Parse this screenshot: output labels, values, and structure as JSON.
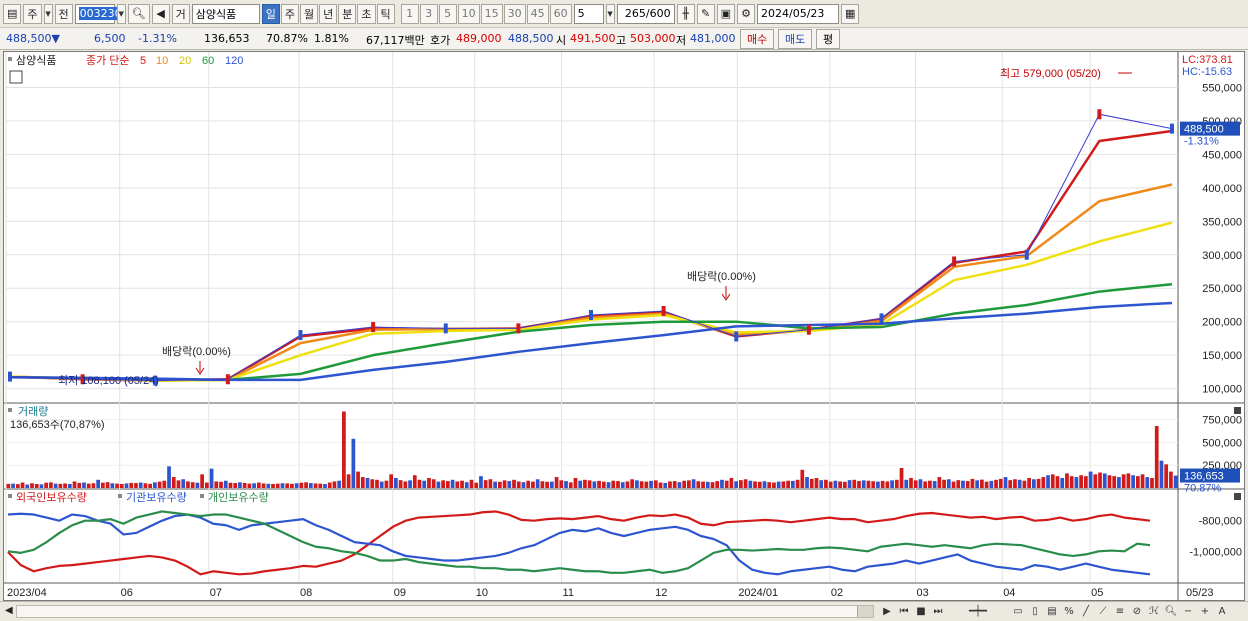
{
  "toolbar": {
    "type_label": "주",
    "prev_label": "전",
    "code": "003230",
    "exchange_label": "거",
    "stock_name": "삼양식품",
    "periods": [
      "일",
      "주",
      "월",
      "년",
      "분",
      "초",
      "틱"
    ],
    "selected_period": "일",
    "intervals": [
      "1",
      "3",
      "5",
      "10",
      "15",
      "30",
      "45",
      "60"
    ],
    "interval_value": "5",
    "count_value": "265",
    "count_max": "/600",
    "date": "2024/05/23"
  },
  "quote": {
    "price": "488,500",
    "change_symbol": "▼",
    "change": "6,500",
    "change_pct": "-1.31%",
    "volume": "136,653",
    "volume_ratio": "70.87%",
    "turnover": "1.81%",
    "amount": "67,117백만",
    "bid_label": "호가",
    "bid": "489,000",
    "ask": "488,500",
    "open_label": "시",
    "open": "491,500",
    "high_label": "고",
    "high": "503,000",
    "low_label": "저",
    "low": "481,000",
    "buy_label": "매수",
    "sell_label": "매도",
    "even_label": "평"
  },
  "chart_data": [
    {
      "type": "candlestick",
      "panel": "price",
      "legend": {
        "name": "삼양식품",
        "ma_label": "종가 단순",
        "periods": [
          "5",
          "10",
          "20",
          "60",
          "120"
        ]
      },
      "x_ticks": [
        "2023/04",
        "06",
        "07",
        "08",
        "09",
        "10",
        "11",
        "12",
        "2024/01",
        "02",
        "03",
        "04",
        "05",
        "05/23"
      ],
      "y_ticks": [
        "100,000",
        "150,000",
        "200,000",
        "250,000",
        "300,000",
        "350,000",
        "400,000",
        "450,000",
        "500,000",
        "550,000"
      ],
      "ylim": [
        80000,
        600000
      ],
      "close_series": {
        "dates": [
          "2023/04",
          "06",
          "07",
          "08",
          "08 late",
          "09",
          "10",
          "11",
          "12",
          "2024/01",
          "02",
          "03",
          "04",
          "04 late",
          "05",
          "05/20",
          "05/23"
        ],
        "values": [
          118000,
          114000,
          112000,
          114000,
          180000,
          192000,
          190000,
          190000,
          210000,
          216000,
          178000,
          188000,
          205000,
          290000,
          300000,
          510000,
          488500
        ]
      },
      "moving_averages": [
        {
          "period": "5",
          "color": "#d21a1a",
          "values": [
            118000,
            114000,
            112000,
            114000,
            178000,
            190000,
            189000,
            190000,
            208000,
            214000,
            178000,
            188000,
            204000,
            288000,
            305000,
            470000,
            485000
          ]
        },
        {
          "period": "10",
          "color": "#ef8a1a",
          "values": [
            118000,
            115000,
            112000,
            113000,
            168000,
            188000,
            189000,
            189000,
            206000,
            212000,
            180000,
            187000,
            201000,
            282000,
            298000,
            380000,
            405000
          ]
        },
        {
          "period": "20",
          "color": "#f0e010",
          "values": [
            118000,
            115000,
            112000,
            113000,
            150000,
            182000,
            186000,
            188000,
            203000,
            210000,
            184000,
            186000,
            196000,
            262000,
            285000,
            320000,
            348000
          ]
        },
        {
          "period": "60",
          "color": "#1f9a3a",
          "values": [
            117000,
            116000,
            114000,
            113000,
            122000,
            150000,
            168000,
            185000,
            195000,
            200000,
            200000,
            190000,
            192000,
            212000,
            225000,
            245000,
            256000
          ]
        },
        {
          "period": "120",
          "color": "#2d55d0",
          "values": [
            117000,
            116000,
            115000,
            113000,
            113000,
            128000,
            140000,
            155000,
            168000,
            180000,
            193000,
            195000,
            197000,
            205000,
            212000,
            222000,
            228000
          ]
        }
      ],
      "annotations": [
        {
          "text": "최고 579,000 (05/20)",
          "value": 579000
        },
        {
          "text": "최저 108,100 (05/24)",
          "value": 108100
        },
        {
          "text": "배당락(0.00%)",
          "date": "06"
        },
        {
          "text": "배당락(0.00%)",
          "date": "12"
        }
      ],
      "right_labels": {
        "lc": "LC:373.81",
        "hc": "HC:-15.63",
        "last": "488,500",
        "last_pct": "-1.31%"
      }
    },
    {
      "type": "bar",
      "panel": "volume",
      "title": "거래량",
      "current": "136,653주(70,87%)",
      "y_ticks": [
        "250,000",
        "500,000",
        "750,000"
      ],
      "ylim": [
        0,
        900000
      ],
      "last_label": "136,653",
      "last_pct": "70.87%",
      "values": [
        45000,
        48000,
        42000,
        60000,
        38000,
        52000,
        44000,
        40000,
        58000,
        62000,
        48000,
        46000,
        50000,
        44000,
        72000,
        56000,
        60000,
        48000,
        52000,
        90000,
        58000,
        64000,
        52000,
        48000,
        44000,
        50000,
        56000,
        54000,
        60000,
        52000,
        46000,
        62000,
        70000,
        80000,
        238000,
        120000,
        84000,
        96000,
        72000,
        64000,
        58000,
        150000,
        60000,
        212000,
        72000,
        68000,
        80000,
        58000,
        54000,
        62000,
        56000,
        48000,
        52000,
        60000,
        50000,
        46000,
        44000,
        48000,
        52000,
        50000,
        46000,
        52000,
        58000,
        62000,
        54000,
        50000,
        48000,
        44000,
        60000,
        72000,
        80000,
        840000,
        150000,
        540000,
        180000,
        120000,
        110000,
        96000,
        90000,
        70000,
        80000,
        150000,
        110000,
        86000,
        72000,
        84000,
        140000,
        90000,
        80000,
        110000,
        96000,
        70000,
        84000,
        76000,
        90000,
        72000,
        80000,
        64000,
        90000,
        58000,
        130000,
        86000,
        96000,
        70000,
        68000,
        84000,
        76000,
        90000,
        72000,
        64000,
        80000,
        70000,
        96000,
        74000,
        68000,
        70000,
        120000,
        84000,
        76000,
        62000,
        110000,
        80000,
        90000,
        84000,
        72000,
        78000,
        70000,
        64000,
        80000,
        76000,
        64000,
        72000,
        96000,
        84000,
        74000,
        70000,
        78000,
        84000,
        60000,
        56000,
        72000,
        76000,
        64000,
        80000,
        84000,
        96000,
        74000,
        70000,
        68000,
        64000,
        76000,
        90000,
        80000,
        110000,
        74000,
        86000,
        96000,
        80000,
        72000,
        68000,
        74000,
        64000,
        60000,
        70000,
        72000,
        80000,
        78000,
        90000,
        200000,
        120000,
        100000,
        110000,
        86000,
        90000,
        70000,
        80000,
        72000,
        68000,
        86000,
        90000,
        76000,
        84000,
        80000,
        74000,
        70000,
        78000,
        72000,
        84000,
        90000,
        220000,
        90000,
        110000,
        84000,
        96000,
        72000,
        80000,
        76000,
        120000,
        90000,
        96000,
        70000,
        86000,
        80000,
        76000,
        100000,
        84000,
        92000,
        70000,
        78000,
        90000,
        100000,
        120000,
        86000,
        96000,
        90000,
        80000,
        110000,
        96000,
        100000,
        120000,
        140000,
        150000,
        130000,
        110000,
        160000,
        130000,
        120000,
        140000,
        130000,
        180000,
        150000,
        170000,
        160000,
        140000,
        130000,
        120000,
        150000,
        160000,
        140000,
        130000,
        150000,
        120000,
        110000,
        680000,
        300000,
        260000,
        180000,
        136653
      ]
    },
    {
      "type": "line",
      "panel": "holdings",
      "series_names": [
        "외국인보유수량",
        "기관보유수량",
        "개인보유수량"
      ],
      "y_ticks": [
        "-800,000",
        "-1,000,000"
      ],
      "ylim": [
        -1200000,
        -600000
      ],
      "series": [
        {
          "name": "외국인보유수량",
          "color": "#d21a1a",
          "values": [
            -1005000,
            -1090000,
            -1130000,
            -1110000,
            -1095000,
            -1090000,
            -1080000,
            -1070000,
            -1060000,
            -1050000,
            -1040000,
            -1030000,
            -1040000,
            -1060000,
            -1100000,
            -1150000,
            -1130000,
            -1140000,
            -1150000,
            -1145000,
            -1130000,
            -1120000,
            -1110000,
            -1095000,
            -1100000,
            -1080000,
            -1060000,
            -1020000,
            -960000,
            -900000,
            -840000,
            -800000,
            -780000,
            -775000,
            -770000,
            -765000,
            -760000,
            -745000,
            -740000,
            -760000,
            -795000,
            -800000,
            -790000,
            -785000,
            -790000,
            -780000,
            -770000,
            -790000,
            -800000,
            -780000,
            -765000,
            -770000,
            -760000,
            -780000,
            -820000,
            -830000,
            -810000,
            -805000,
            -800000,
            -795000,
            -800000,
            -810000,
            -800000,
            -790000,
            -780000,
            -790000,
            -790000,
            -810000,
            -800000,
            -790000,
            -770000,
            -755000,
            -750000,
            -760000,
            -770000,
            -780000,
            -775000,
            -790000,
            -780000,
            -775000,
            -800000,
            -795000,
            -780000,
            -800000,
            -790000,
            -770000,
            -760000,
            -780000,
            -790000,
            -800000
          ]
        },
        {
          "name": "기관보유수량",
          "color": "#2d55d0",
          "values": [
            -760000,
            -755000,
            -760000,
            -780000,
            -800000,
            -760000,
            -770000,
            -800000,
            -820000,
            -890000,
            -880000,
            -840000,
            -800000,
            -770000,
            -760000,
            -780000,
            -820000,
            -830000,
            -860000,
            -830000,
            -820000,
            -810000,
            -800000,
            -790000,
            -830000,
            -860000,
            -900000,
            -940000,
            -950000,
            -960000,
            -1000000,
            -1030000,
            -1040000,
            -1050000,
            -1060000,
            -1060000,
            -1050000,
            -1040000,
            -1030000,
            -1010000,
            -980000,
            -960000,
            -920000,
            -880000,
            -860000,
            -870000,
            -850000,
            -880000,
            -900000,
            -880000,
            -860000,
            -850000,
            -840000,
            -860000,
            -900000,
            -920000,
            -960000,
            -1060000,
            -1120000,
            -1140000,
            -1150000,
            -1130000,
            -1120000,
            -1110000,
            -1100000,
            -1120000,
            -1130000,
            -1100000,
            -1090000,
            -1080000,
            -1060000,
            -1080000,
            -1060000,
            -1040000,
            -1020000,
            -1060000,
            -1080000,
            -1100000,
            -1110000,
            -1120000,
            -1090000,
            -1100000,
            -1120000,
            -1100000,
            -1080000,
            -1100000,
            -1120000,
            -1130000,
            -1140000,
            -1150000
          ]
        },
        {
          "name": "개인보유수량",
          "color": "#2a8c4a",
          "values": [
            -1000000,
            -1010000,
            -990000,
            -940000,
            -880000,
            -830000,
            -800000,
            -800000,
            -790000,
            -820000,
            -780000,
            -760000,
            -740000,
            -750000,
            -760000,
            -770000,
            -760000,
            -760000,
            -780000,
            -800000,
            -820000,
            -860000,
            -900000,
            -940000,
            -970000,
            -980000,
            -1000000,
            -1010000,
            -1030000,
            -1060000,
            -1060000,
            -1050000,
            -1070000,
            -1080000,
            -1090000,
            -1100000,
            -1100000,
            -1110000,
            -1110000,
            -1120000,
            -1120000,
            -1130000,
            -1120000,
            -1110000,
            -1120000,
            -1130000,
            -1130000,
            -1140000,
            -1140000,
            -1130000,
            -1120000,
            -1140000,
            -1130000,
            -1110000,
            -1060000,
            -1010000,
            -990000,
            -990000,
            -995000,
            -990000,
            -985000,
            -990000,
            -990000,
            -980000,
            -975000,
            -980000,
            -990000,
            -1000000,
            -970000,
            -960000,
            -950000,
            -960000,
            -970000,
            -960000,
            -970000,
            -980000,
            -960000,
            -950000,
            -955000,
            -960000,
            -980000,
            -1000000,
            -1020000,
            -1030000,
            -1020000,
            -1000000,
            -995000,
            -1000000,
            -950000,
            -960000
          ]
        }
      ]
    }
  ],
  "icons": [
    "chart-type-icon",
    "search-icon",
    "speaker-icon",
    "candle-icon",
    "draw-icon",
    "save-icon",
    "gear-icon",
    "calendar-icon"
  ]
}
